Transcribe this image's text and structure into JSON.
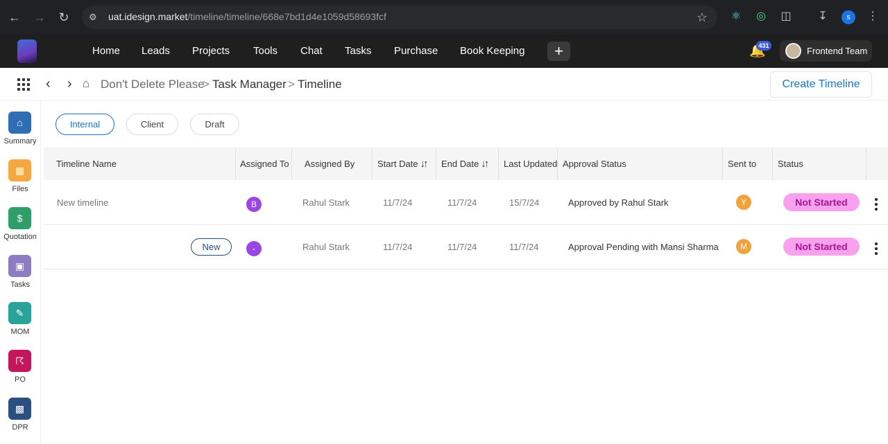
{
  "browser": {
    "url_host": "uat.idesign.market",
    "url_path": "/timeline/timeline/668e7bd1d4e1059d58693fcf",
    "profile_initial": "s"
  },
  "nav": {
    "items": [
      "Home",
      "Leads",
      "Projects",
      "Tools",
      "Chat",
      "Tasks",
      "Purchase",
      "Book Keeping"
    ],
    "plus_label": "+",
    "notification_count": "431",
    "team_label": "Frontend Team"
  },
  "breadcrumb": {
    "items": [
      "Don't Delete Please",
      "Task Manager",
      "Timeline"
    ],
    "separator": ">"
  },
  "create_button": "Create Timeline",
  "sidebar": {
    "items": [
      {
        "label": "Summary",
        "icon": "home-icon",
        "color": "#2f6db5"
      },
      {
        "label": "Files",
        "icon": "folder-icon",
        "color": "#f5a742"
      },
      {
        "label": "Quotation",
        "icon": "dollar-icon",
        "color": "#2e9e6a"
      },
      {
        "label": "Tasks",
        "icon": "task-icon",
        "color": "#8e7cc3"
      },
      {
        "label": "MOM",
        "icon": "edit-icon",
        "color": "#2aa39a"
      },
      {
        "label": "PO",
        "icon": "cart-icon",
        "color": "#c2185b"
      },
      {
        "label": "DPR",
        "icon": "calendar-icon",
        "color": "#2b4f7e"
      }
    ]
  },
  "filters": [
    "Internal",
    "Client",
    "Draft"
  ],
  "table": {
    "headers": [
      "Timeline Name",
      "Assigned To",
      "Assigned By",
      "Start Date",
      "End Date",
      "Last Updated",
      "Approval Status",
      "Sent to",
      "Status"
    ],
    "rows": [
      {
        "name": "New timeline",
        "badge": "",
        "assigned_to": "B",
        "assigned_to_color": "#9b45e4",
        "assigned_by": "Rahul Stark",
        "start_date": "11/7/24",
        "end_date": "11/7/24",
        "last_updated": "15/7/24",
        "approval_status": "Approved by Rahul Stark",
        "sent_to": "Y",
        "sent_to_color": "#f0a23b",
        "status": "Not Started"
      },
      {
        "name": "",
        "badge": "New",
        "assigned_to": "-",
        "assigned_to_color": "#9b45e4",
        "assigned_by": "Rahul Stark",
        "start_date": "11/7/24",
        "end_date": "11/7/24",
        "last_updated": "11/7/24",
        "approval_status": "Approval Pending with Mansi Sharma",
        "sent_to": "M",
        "sent_to_color": "#f0a23b",
        "status": "Not Started"
      }
    ]
  }
}
